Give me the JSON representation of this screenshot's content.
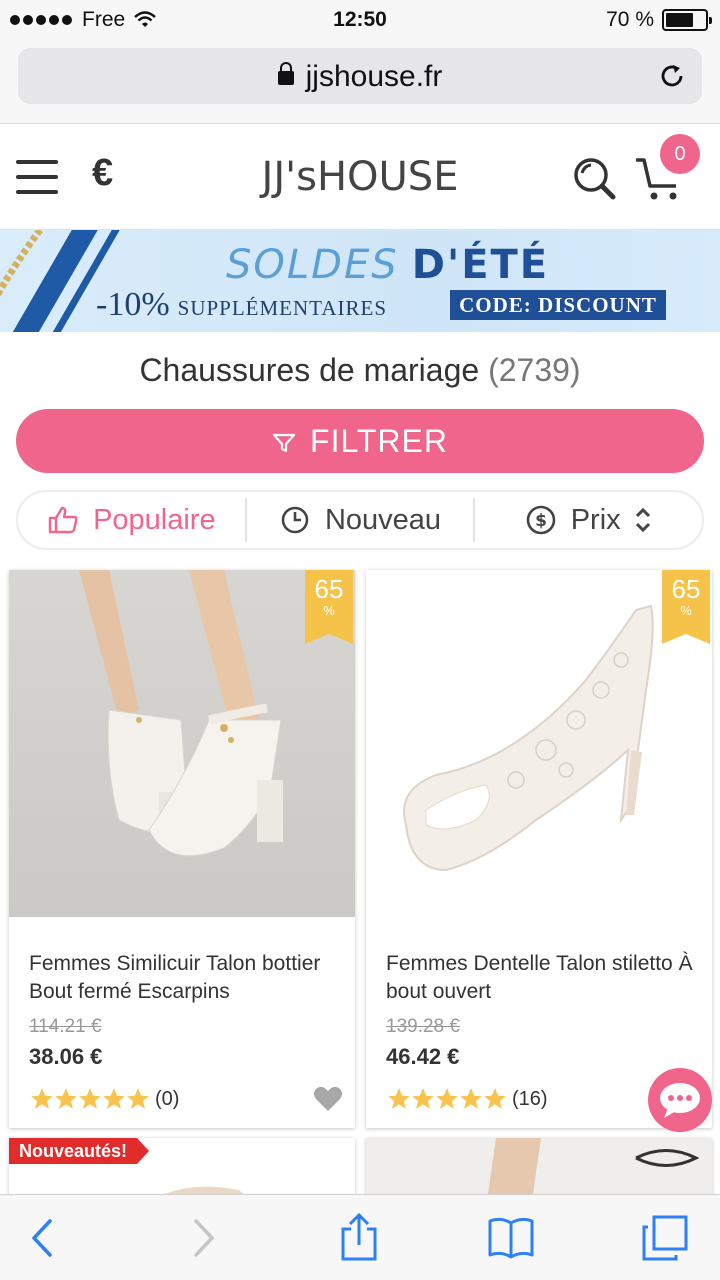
{
  "status_bar": {
    "carrier": "Free",
    "time": "12:50",
    "battery_text": "70 %",
    "battery_level": 0.7
  },
  "browser": {
    "url": "jjshouse.fr"
  },
  "header": {
    "currency": "€",
    "logo": "JJ'sHOUSE",
    "cart_count": "0"
  },
  "banner": {
    "title_part1": "SOLDES",
    "title_part2": "D'ÉTÉ",
    "discount": "-10%",
    "discount_text": "SUPPLÉMENTAIRES",
    "code": "CODE: DISCOUNT"
  },
  "category": {
    "title": "Chaussures de mariage",
    "count": "(2739)"
  },
  "filter": {
    "label": "FILTRER"
  },
  "sort": [
    {
      "label": "Populaire",
      "icon": "thumbs-up-icon",
      "active": true
    },
    {
      "label": "Nouveau",
      "icon": "clock-icon",
      "active": false
    },
    {
      "label": "Prix",
      "icon": "dollar-icon",
      "active": false
    }
  ],
  "products": [
    {
      "discount": "65",
      "discount_unit": "%",
      "name": "Femmes Similicuir Talon bottier Bout fermé Escarpins",
      "old_price": "114.21 €",
      "price": "38.06 €",
      "rating": 5,
      "reviews": "(0)"
    },
    {
      "discount": "65",
      "discount_unit": "%",
      "name": "Femmes Dentelle Talon stiletto À bout ouvert",
      "old_price": "139.28 €",
      "price": "46.42 €",
      "rating": 5,
      "reviews": "(16)"
    }
  ],
  "next_row": {
    "new_tag": "Nouveautés!"
  },
  "colors": {
    "accent": "#f0658b",
    "ribbon": "#f6c34a",
    "banner_blue": "#1f4f96"
  }
}
